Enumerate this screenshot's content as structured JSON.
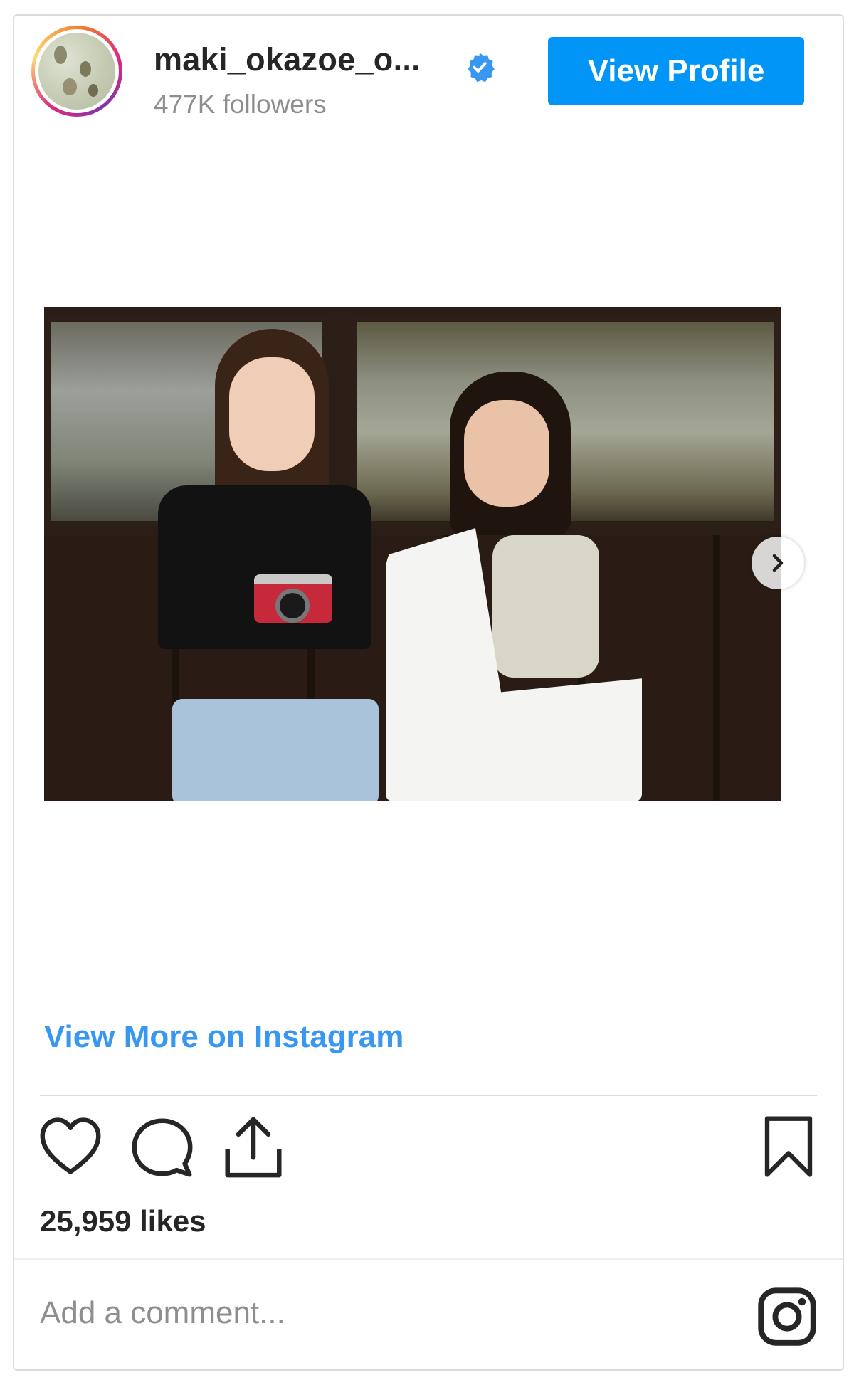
{
  "header": {
    "username": "maki_okazoe_o...",
    "followers": "477K followers",
    "view_profile_label": "View Profile"
  },
  "post": {
    "view_more_label": "View More on Instagram",
    "likes": "25,959 likes",
    "comment_placeholder": "Add a comment..."
  },
  "icons": {
    "verified": "verified-badge-icon",
    "next": "chevron-right-icon",
    "like": "heart-icon",
    "comment": "comment-bubble-icon",
    "share": "share-icon",
    "save": "bookmark-icon",
    "instagram": "instagram-logo-icon"
  },
  "colors": {
    "accent": "#0095f6",
    "link": "#3897f0",
    "muted": "#8e8e8e",
    "text": "#262626"
  }
}
